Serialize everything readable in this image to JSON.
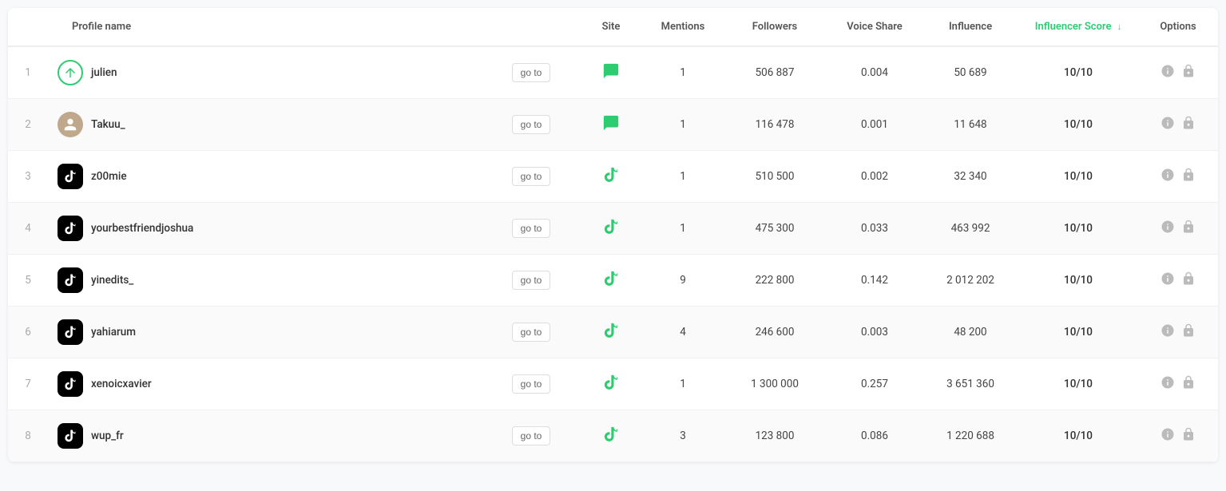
{
  "colors": {
    "green": "#2ecc71",
    "text_primary": "#333",
    "text_secondary": "#999",
    "border": "#eee"
  },
  "columns": {
    "rank": "",
    "profile_name": "Profile name",
    "site": "Site",
    "mentions": "Mentions",
    "followers": "Followers",
    "voice_share": "Voice Share",
    "influence": "Influence",
    "influencer_score": "Influencer Score",
    "options": "Options",
    "goto_label": "go to",
    "sort_arrow": "↓"
  },
  "rows": [
    {
      "rank": "1",
      "username": "julien",
      "avatar_type": "discord",
      "site_type": "discord",
      "mentions": "1",
      "followers": "506 887",
      "voice_share": "0.004",
      "influence": "50 689",
      "influencer_score": "10/10"
    },
    {
      "rank": "2",
      "username": "Takuu_",
      "avatar_type": "custom",
      "site_type": "discord",
      "mentions": "1",
      "followers": "116 478",
      "voice_share": "0.001",
      "influence": "11 648",
      "influencer_score": "10/10"
    },
    {
      "rank": "3",
      "username": "z00mie",
      "avatar_type": "tiktok",
      "site_type": "tiktok",
      "mentions": "1",
      "followers": "510 500",
      "voice_share": "0.002",
      "influence": "32 340",
      "influencer_score": "10/10"
    },
    {
      "rank": "4",
      "username": "yourbestfriendjoshua",
      "avatar_type": "tiktok",
      "site_type": "tiktok",
      "mentions": "1",
      "followers": "475 300",
      "voice_share": "0.033",
      "influence": "463 992",
      "influencer_score": "10/10"
    },
    {
      "rank": "5",
      "username": "yinedits_",
      "avatar_type": "tiktok",
      "site_type": "tiktok",
      "mentions": "9",
      "followers": "222 800",
      "voice_share": "0.142",
      "influence": "2 012 202",
      "influencer_score": "10/10"
    },
    {
      "rank": "6",
      "username": "yahiarum",
      "avatar_type": "tiktok",
      "site_type": "tiktok",
      "mentions": "4",
      "followers": "246 600",
      "voice_share": "0.003",
      "influence": "48 200",
      "influencer_score": "10/10"
    },
    {
      "rank": "7",
      "username": "xenoicxavier",
      "avatar_type": "tiktok",
      "site_type": "tiktok",
      "mentions": "1",
      "followers": "1 300 000",
      "voice_share": "0.257",
      "influence": "3 651 360",
      "influencer_score": "10/10"
    },
    {
      "rank": "8",
      "username": "wup_fr",
      "avatar_type": "tiktok",
      "site_type": "tiktok",
      "mentions": "3",
      "followers": "123 800",
      "voice_share": "0.086",
      "influence": "1 220 688",
      "influencer_score": "10/10"
    }
  ]
}
